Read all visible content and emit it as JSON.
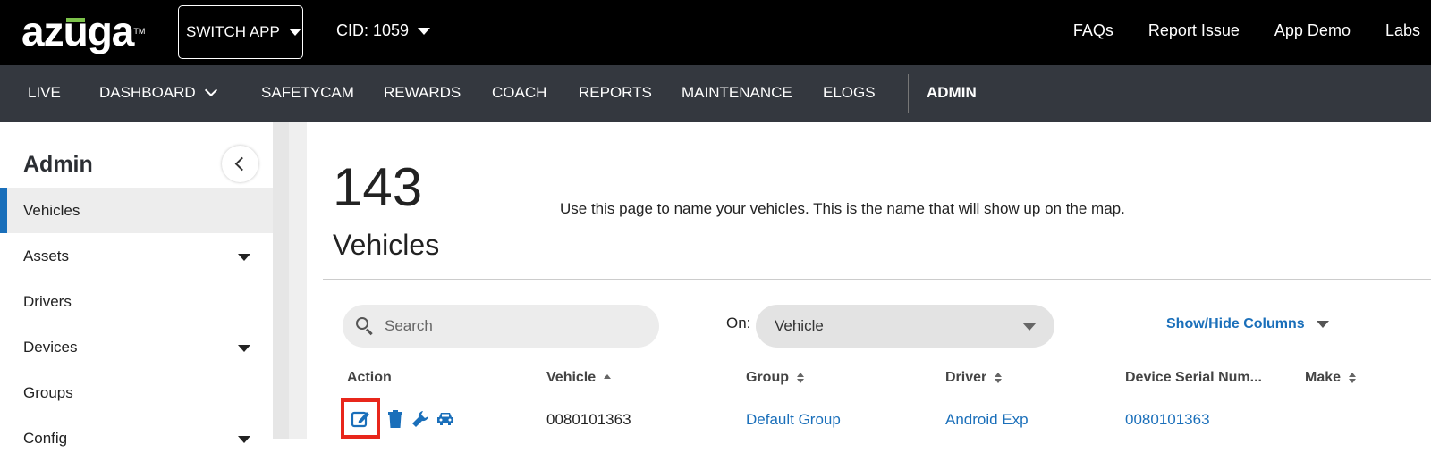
{
  "header": {
    "logo_text": "azuga",
    "logo_tm": "TM",
    "switch_app_label": "SWITCH APP",
    "cid_label": "CID: 1059",
    "links": [
      "FAQs",
      "Report Issue",
      "App Demo",
      "Labs"
    ]
  },
  "nav": {
    "live": "LIVE",
    "dashboard": "DASHBOARD",
    "safetycam": "SAFETYCAM",
    "rewards": "REWARDS",
    "coach": "COACH",
    "reports": "REPORTS",
    "maintenance": "MAINTENANCE",
    "elogs": "ELOGS",
    "admin": "ADMIN"
  },
  "sidebar": {
    "title": "Admin",
    "items": [
      {
        "label": "Vehicles",
        "active": true
      },
      {
        "label": "Assets",
        "expandable": true
      },
      {
        "label": "Drivers"
      },
      {
        "label": "Devices",
        "expandable": true
      },
      {
        "label": "Groups"
      },
      {
        "label": "Config",
        "expandable": true
      }
    ]
  },
  "main": {
    "count": "143",
    "count_label": "Vehicles",
    "description": "Use this page to name your vehicles. This is the name that will show up on the map.",
    "search_placeholder": "Search",
    "on_label": "On:",
    "on_value": "Vehicle",
    "show_hide_label": "Show/Hide Columns"
  },
  "table": {
    "columns": [
      "Action",
      "Vehicle",
      "Group",
      "Driver",
      "Device Serial Num...",
      "Make"
    ],
    "rows": [
      {
        "vehicle": "0080101363",
        "group": "Default Group",
        "driver": "Android Exp",
        "device_serial": "0080101363"
      }
    ]
  },
  "colors": {
    "topbar": "#000000",
    "navbar": "#34383f",
    "accent_blue": "#1a6fba",
    "highlight_red": "#e8261b",
    "logo_green": "#7cc24a"
  },
  "icons": [
    "search-icon",
    "edit-icon",
    "trash-icon",
    "wrench-icon",
    "car-settings-icon",
    "chevron-left-icon"
  ]
}
